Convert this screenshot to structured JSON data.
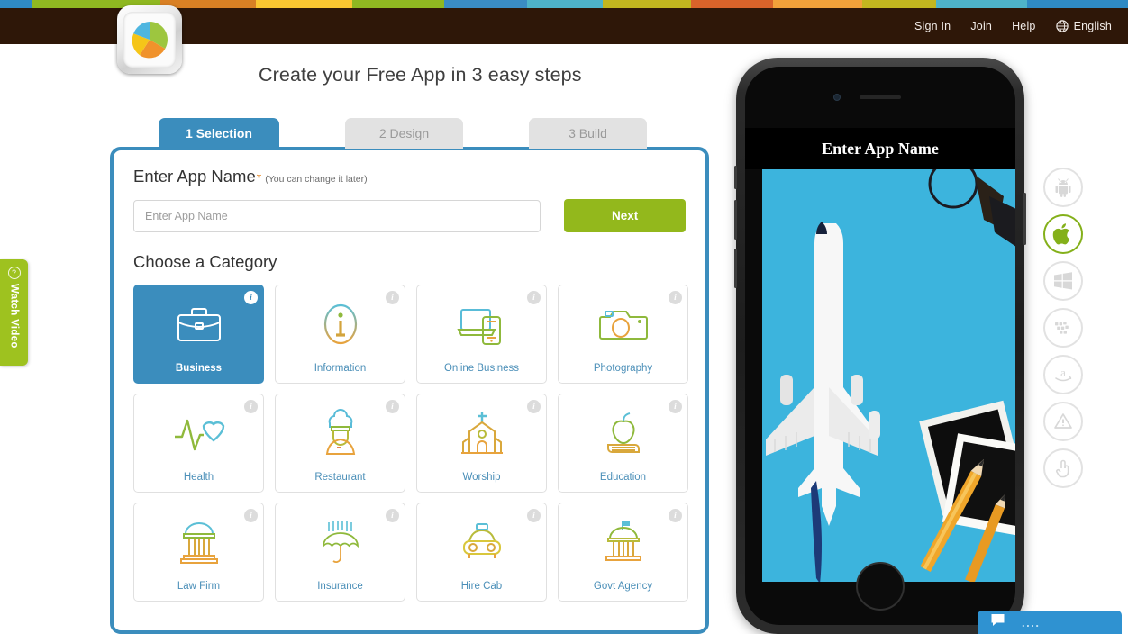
{
  "stripe": {
    "colors": [
      "#2f8ac4",
      "#8fb821",
      "#d98024",
      "#fbc631",
      "#8fb821",
      "#3a8cc4",
      "#4eb3c9",
      "#c3b61f",
      "#d9632a",
      "#f2a13a",
      "#c3b61f",
      "#4eb3c9",
      "#2f8ac4"
    ]
  },
  "header": {
    "background": "#2e1708",
    "nav": [
      {
        "label": "Sign In",
        "name": "sign-in-link"
      },
      {
        "label": "Join",
        "name": "join-link"
      },
      {
        "label": "Help",
        "name": "help-link"
      }
    ],
    "language": "English"
  },
  "logo": {
    "icon": "pie-chart-logo-icon"
  },
  "headline": "Create your Free App in 3 easy steps",
  "tabs": [
    {
      "label": "1 Selection",
      "active": true
    },
    {
      "label": "2 Design",
      "active": false
    },
    {
      "label": "3 Build",
      "active": false
    }
  ],
  "form": {
    "label": "Enter App Name",
    "required_mark": "*",
    "hint": "(You can change it later)",
    "input_placeholder": "Enter App Name",
    "input_value": "",
    "next_label": "Next"
  },
  "categories": {
    "heading": "Choose a Category",
    "info_glyph": "i",
    "items": [
      {
        "label": "Business",
        "icon": "briefcase-icon",
        "selected": true
      },
      {
        "label": "Information",
        "icon": "information-icon",
        "selected": false
      },
      {
        "label": "Online Business",
        "icon": "laptop-phone-icon",
        "selected": false
      },
      {
        "label": "Photography",
        "icon": "camera-icon",
        "selected": false
      },
      {
        "label": "Health",
        "icon": "heartbeat-icon",
        "selected": false
      },
      {
        "label": "Restaurant",
        "icon": "chef-icon",
        "selected": false
      },
      {
        "label": "Worship",
        "icon": "church-icon",
        "selected": false
      },
      {
        "label": "Education",
        "icon": "apple-books-icon",
        "selected": false
      },
      {
        "label": "Law Firm",
        "icon": "courthouse-icon",
        "selected": false
      },
      {
        "label": "Insurance",
        "icon": "umbrella-rain-icon",
        "selected": false
      },
      {
        "label": "Hire Cab",
        "icon": "taxi-icon",
        "selected": false
      },
      {
        "label": "Govt Agency",
        "icon": "capitol-flag-icon",
        "selected": false
      }
    ]
  },
  "preview": {
    "app_title": "Enter App Name",
    "screen_description": "model-airplane-on-blue-desk-photo"
  },
  "platforms": [
    {
      "name": "android-icon",
      "active": false
    },
    {
      "name": "apple-icon",
      "active": true
    },
    {
      "name": "windows-icon",
      "active": false
    },
    {
      "name": "blackberry-icon",
      "active": false
    },
    {
      "name": "amazon-icon",
      "active": false
    },
    {
      "name": "warning-icon",
      "active": false
    },
    {
      "name": "hand-touch-icon",
      "active": false
    }
  ],
  "watch_video": {
    "label": "Watch Video",
    "glyph": "?"
  },
  "chat": {
    "dots": "...."
  },
  "accent": {
    "blue": "#3b8dbd",
    "green": "#93b81c",
    "orange": "#e98b2a"
  }
}
